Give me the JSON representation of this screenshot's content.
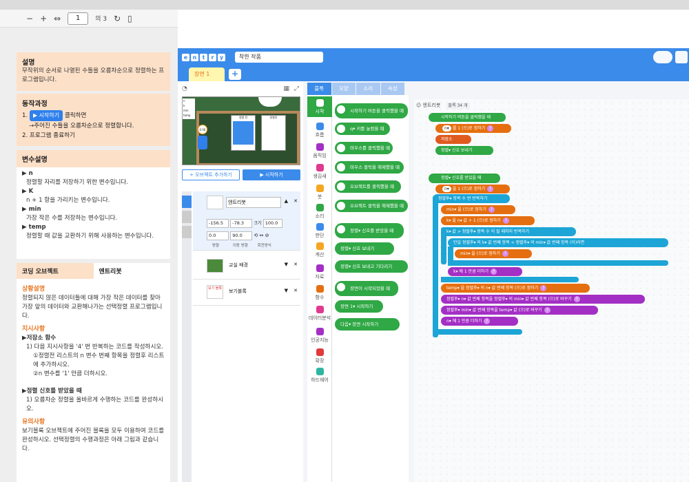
{
  "pdf": {
    "minus": "−",
    "plus": "+",
    "page": "1",
    "of": "의 3"
  },
  "doc": {
    "desc_title": "설명",
    "desc_text": "무작위의 순서로 나열된 수들을 오름차순으로 정렬하는 프로그램입니다.",
    "proc_title": "동작과정",
    "proc_1_num": "1.",
    "proc_1_btn": "시작하기",
    "proc_1_after": "클릭하면",
    "proc_1b": "→주어진 수들을 오름차순으로 정렬합니다.",
    "proc_2": "2.  프로그램 종료하기",
    "var_title": "변수설명",
    "var_n": "▶ n",
    "var_n_d": "정렬할 자리를 저장하기 위한 변수입니다.",
    "var_k": "▶ K",
    "var_k_d": "n + 1 항을 가리키는 변수입니다.",
    "var_min": "▶ min",
    "var_min_d": "가장 작은 수를 저장하는 변수입니다.",
    "var_temp": "▶ temp",
    "var_temp_d": "정렬할 때 값을 교환하기 위해 사용하는 변수입니다.",
    "tab1": "코딩 오브젝트",
    "tab2": "엔트리봇",
    "sit_title": "상황설명",
    "sit_text": "정렬되지 않은 데이터들에 대해 가장 작은 데이터를 찾아 가장 앞의 데이터와 교환해나가는 선택정렬 프로그램입니다.",
    "ins_title": "지시사항",
    "ins_1": "▶저장소 함수",
    "ins_1a": "1) 다음 지시사항을 '4' 번 반복하는 코드를 작성하시오.",
    "ins_1b": "①정렬전 리스트의 n 변수 번째 항목을 정렬후 리스트에 추가하시오.",
    "ins_1c": "②n 변수를 '1' 만큼 더하시오.",
    "ins_2": "▶정렬 신호를 받았을 때",
    "ins_2a": "1) 오름차순 정렬을 올바르게 수행하는 코드를 완성하시오.",
    "caut_title": "유의사항",
    "caut_text": "보기블록 오브젝트에 주어진 블록을 모두 이용하여 코드를 완성하시오. 선택정렬의 수행과정은 아래 그림과 같습니다."
  },
  "app": {
    "logo": [
      "e",
      "n",
      "t",
      "r",
      "y"
    ],
    "project": "착한 작품",
    "scene_tab": "장면 1",
    "scene_close": "✕",
    "add_object": "+ 오브젝트 추가하기",
    "start": "▶ 시작하기",
    "stage_labels": {
      "n": "n",
      "k": "k",
      "min": "min",
      "temp": "temp",
      "before": "정렬 전",
      "after": "정렬후",
      "counter": "0·56"
    },
    "objects": [
      {
        "name": "엔트리봇",
        "x": "-156.5",
        "y": "-78.3",
        "size_label": "크기",
        "size": "100.0",
        "rot": "0.0",
        "dir": "90.0",
        "rot_label": "방향",
        "dir_label": "이동 방향",
        "rmode": "회전방식"
      },
      {
        "name": "교실 배경"
      },
      {
        "name": "보기블록",
        "icon_text": "보기 블록"
      }
    ],
    "palette_tabs": [
      "블록",
      "모양",
      "소리",
      "속성"
    ],
    "categories": [
      "시작",
      "흐름",
      "움직임",
      "생김새",
      "붓",
      "소리",
      "판단",
      "계산",
      "자료",
      "함수",
      "데이터분석",
      "인공지능",
      "확장",
      "하드웨어"
    ],
    "palette_blocks": [
      "시작하기 버튼을 클릭했을 때",
      "q▾  키를 눌렀을 때",
      "마우스를 클릭했을 때",
      "마우스 클릭을 해제했을 때",
      "오브젝트를 클릭했을 때",
      "오브젝트 클릭을 해제했을 때",
      "정렬▾  신호를 받았을 때",
      "정렬▾  신호 보내기",
      "정렬▾  신호 보내고 기다리기",
      "장면이 시작되었을 때",
      "장면 1▾  시작하기",
      "다음▾  장면 시작하기"
    ],
    "code_header": "엔트리봇",
    "block_count": "블록 34 개",
    "code": {
      "s1": "시작하기 버튼을 클릭했을 때",
      "s2": "를 1 (으)로 정하기",
      "s2var": "n▾",
      "s3": "저장소",
      "s4": "정렬▾  신호 보내기",
      "r1": "정렬▾  신호를 받았을 때",
      "r2": "을 1 (으)로 정하기",
      "r3": "정렬후▾  항목 수  번 반복하기",
      "r4": "min▾  을  (으)로 정하기",
      "r5": "k▾  을  n▾ 값 + 1  (으)로 정하기",
      "r6": "k▾ 값  >  정렬후▾ 항목 수  이 될 때까지  반복하기",
      "r7": "만일  정렬후▾ 의 k▾ 값 번째 항목  <  정렬후▾ 의 min▾ 값 번째 항목  (이)라면",
      "r8": "min▾  을  (으)로 정하기",
      "r9": "k▾  에  1  만큼 더하기",
      "r10": "temp▾  을  정렬후▾ 의 n▾ 값 번째 항목  (으)로 정하기",
      "r11": "정렬후▾  n▾ 값 번째 항목을  정렬후▾ 의 min▾ 값 번째 항목  (으)로 바꾸기",
      "r12": "정렬후▾  min▾ 값 번째 항목을  temp▾ 값  (으)로 바꾸기",
      "r13": "n▾  에  1  만큼 더하기"
    }
  }
}
